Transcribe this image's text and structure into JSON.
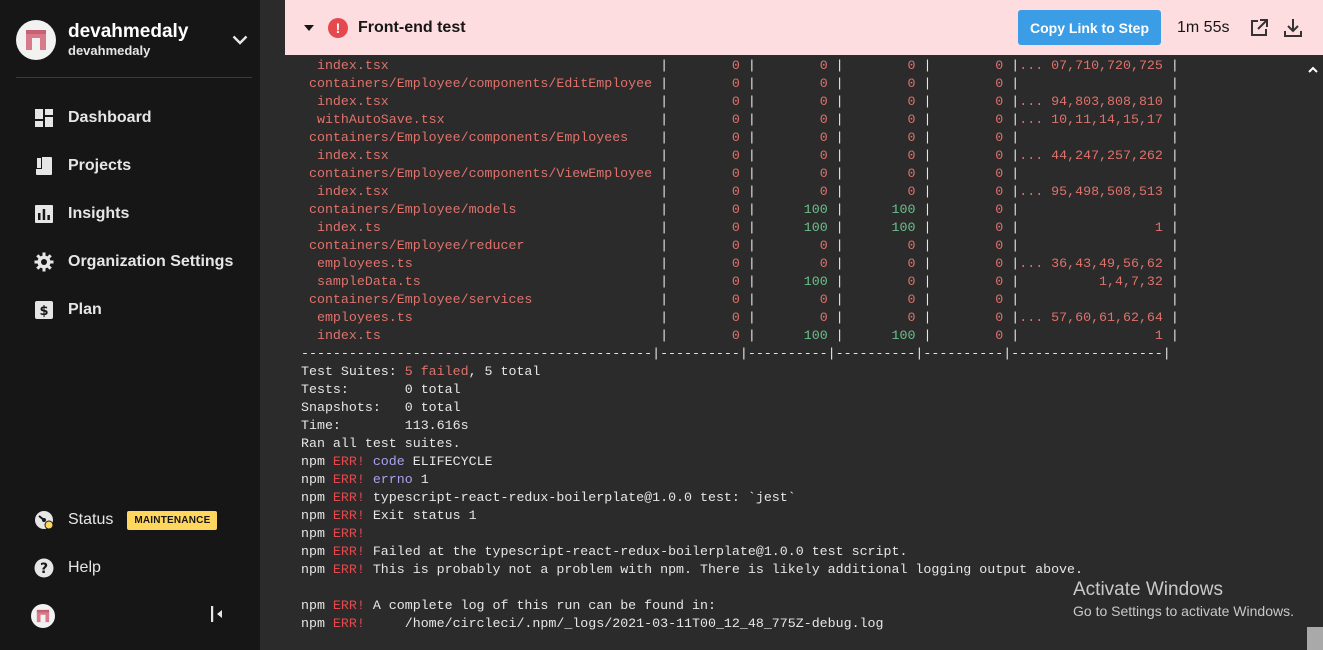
{
  "sidebar": {
    "org_name": "devahmedaly",
    "org_sub": "devahmedaly",
    "nav": [
      {
        "label": "Dashboard",
        "icon": "dashboard-icon"
      },
      {
        "label": "Projects",
        "icon": "projects-icon"
      },
      {
        "label": "Insights",
        "icon": "insights-icon"
      },
      {
        "label": "Organization Settings",
        "icon": "gear-icon"
      },
      {
        "label": "Plan",
        "icon": "dollar-icon"
      }
    ],
    "status_label": "Status",
    "status_badge": "MAINTENANCE",
    "help_label": "Help"
  },
  "step": {
    "title": "Front-end test",
    "copy_label": "Copy Link to Step",
    "duration": "1m 55s"
  },
  "colors": {
    "header_bg": "#fddde0",
    "error_red": "#e5484d",
    "copy_blue": "#3b9de6",
    "badge_yellow": "#ffd75e",
    "log_red": "#e0726b",
    "log_green": "#6cc08b"
  },
  "log": {
    "coverage_rows": [
      {
        "file": "  index.tsx",
        "cells": [
          "0",
          "0",
          "0",
          "0"
        ],
        "uncovered": "... 07,710,720,725",
        "status": [
          "r",
          "r",
          "r",
          "r"
        ]
      },
      {
        "file": " containers/Employee/components/EditEmployee",
        "cells": [
          "0",
          "0",
          "0",
          "0"
        ],
        "uncovered": "",
        "status": [
          "r",
          "r",
          "r",
          "r"
        ]
      },
      {
        "file": "  index.tsx",
        "cells": [
          "0",
          "0",
          "0",
          "0"
        ],
        "uncovered": "... 94,803,808,810",
        "status": [
          "r",
          "r",
          "r",
          "r"
        ]
      },
      {
        "file": "  withAutoSave.tsx",
        "cells": [
          "0",
          "0",
          "0",
          "0"
        ],
        "uncovered": "... 10,11,14,15,17",
        "status": [
          "r",
          "r",
          "r",
          "r"
        ]
      },
      {
        "file": " containers/Employee/components/Employees",
        "cells": [
          "0",
          "0",
          "0",
          "0"
        ],
        "uncovered": "",
        "status": [
          "r",
          "r",
          "r",
          "r"
        ]
      },
      {
        "file": "  index.tsx",
        "cells": [
          "0",
          "0",
          "0",
          "0"
        ],
        "uncovered": "... 44,247,257,262",
        "status": [
          "r",
          "r",
          "r",
          "r"
        ]
      },
      {
        "file": " containers/Employee/components/ViewEmployee",
        "cells": [
          "0",
          "0",
          "0",
          "0"
        ],
        "uncovered": "",
        "status": [
          "r",
          "r",
          "r",
          "r"
        ]
      },
      {
        "file": "  index.tsx",
        "cells": [
          "0",
          "0",
          "0",
          "0"
        ],
        "uncovered": "... 95,498,508,513",
        "status": [
          "r",
          "r",
          "r",
          "r"
        ]
      },
      {
        "file": " containers/Employee/models",
        "cells": [
          "0",
          "100",
          "100",
          "0"
        ],
        "uncovered": "",
        "status": [
          "r",
          "g",
          "g",
          "r"
        ]
      },
      {
        "file": "  index.ts",
        "cells": [
          "0",
          "100",
          "100",
          "0"
        ],
        "uncovered": "1",
        "status": [
          "r",
          "g",
          "g",
          "r"
        ]
      },
      {
        "file": " containers/Employee/reducer",
        "cells": [
          "0",
          "0",
          "0",
          "0"
        ],
        "uncovered": "",
        "status": [
          "r",
          "r",
          "r",
          "r"
        ]
      },
      {
        "file": "  employees.ts",
        "cells": [
          "0",
          "0",
          "0",
          "0"
        ],
        "uncovered": "... 36,43,49,56,62",
        "status": [
          "r",
          "r",
          "r",
          "r"
        ]
      },
      {
        "file": "  sampleData.ts",
        "cells": [
          "0",
          "100",
          "0",
          "0"
        ],
        "uncovered": "1,4,7,32",
        "status": [
          "r",
          "g",
          "r",
          "r"
        ]
      },
      {
        "file": " containers/Employee/services",
        "cells": [
          "0",
          "0",
          "0",
          "0"
        ],
        "uncovered": "",
        "status": [
          "r",
          "r",
          "r",
          "r"
        ]
      },
      {
        "file": "  employees.ts",
        "cells": [
          "0",
          "0",
          "0",
          "0"
        ],
        "uncovered": "... 57,60,61,62,64",
        "status": [
          "r",
          "r",
          "r",
          "r"
        ]
      },
      {
        "file": "  index.ts",
        "cells": [
          "0",
          "100",
          "100",
          "0"
        ],
        "uncovered": "1",
        "status": [
          "r",
          "g",
          "g",
          "r"
        ]
      }
    ],
    "divider": "--------------------------------------------|----------|----------|----------|----------|-------------------|",
    "summary": {
      "suites_label": "Test Suites: ",
      "suites_failed": "5 failed",
      "suites_total": ", 5 total",
      "tests": "Tests:       0 total",
      "snapshots": "Snapshots:   0 total",
      "time": "Time:        113.616s",
      "ran": "Ran all test suites."
    },
    "npm_lines": [
      {
        "tail": " ",
        "key": "code",
        "rest": " ELIFECYCLE"
      },
      {
        "tail": " ",
        "key": "errno",
        "rest": " 1"
      },
      {
        "tail": " ",
        "key": "",
        "rest": "typescript-react-redux-boilerplate@1.0.0 test: `jest`"
      },
      {
        "tail": " ",
        "key": "",
        "rest": "Exit status 1"
      },
      {
        "tail": "",
        "key": "",
        "rest": ""
      },
      {
        "tail": " ",
        "key": "",
        "rest": "Failed at the typescript-react-redux-boilerplate@1.0.0 test script."
      },
      {
        "tail": " ",
        "key": "",
        "rest": "This is probably not a problem with npm. There is likely additional logging output above."
      },
      {
        "blank": true
      },
      {
        "tail": " ",
        "key": "",
        "rest": "A complete log of this run can be found in:"
      },
      {
        "tail": " ",
        "key": "",
        "rest": "    /home/circleci/.npm/_logs/2021-03-11T00_12_48_775Z-debug.log"
      }
    ],
    "npm_prefix": "npm ",
    "npm_err": "ERR!"
  },
  "watermark": {
    "title": "Activate Windows",
    "subtitle": "Go to Settings to activate Windows."
  }
}
